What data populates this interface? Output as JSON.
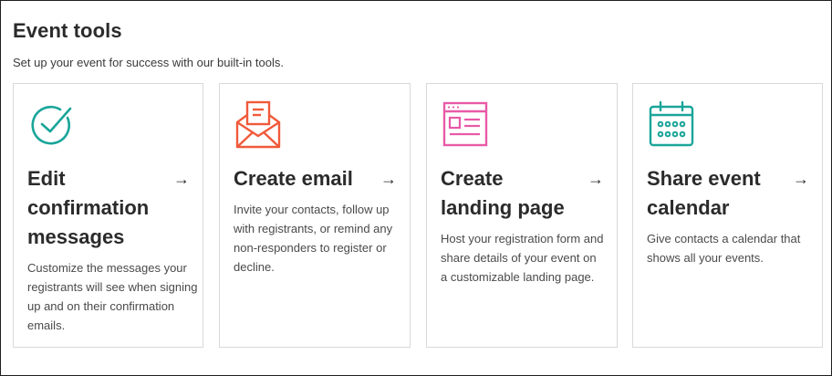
{
  "section": {
    "title": "Event tools",
    "subtitle": "Set up your event for success with our built-in tools."
  },
  "cards": [
    {
      "icon": "check-circle-icon",
      "title_lines": [
        "Edit",
        "confirmation",
        "messages"
      ],
      "description": "Customize the messages your registrants will see when signing up and on their confirmation emails.",
      "color": "#1aa59a"
    },
    {
      "icon": "email-envelope-icon",
      "title_lines": [
        "Create email"
      ],
      "description": "Invite your contacts, follow up with registrants, or remind any non-responders to register or decline.",
      "color": "#f05a3a"
    },
    {
      "icon": "landing-page-icon",
      "title_lines": [
        "Create",
        "landing page"
      ],
      "description": "Host your registration form and share details of your event on a customizable landing page.",
      "color": "#e85aa6"
    },
    {
      "icon": "calendar-icon",
      "title_lines": [
        "Share event",
        "calendar"
      ],
      "description": "Give contacts a calendar that shows all your events.",
      "color": "#1aa59a"
    }
  ],
  "arrow_glyph": "→"
}
